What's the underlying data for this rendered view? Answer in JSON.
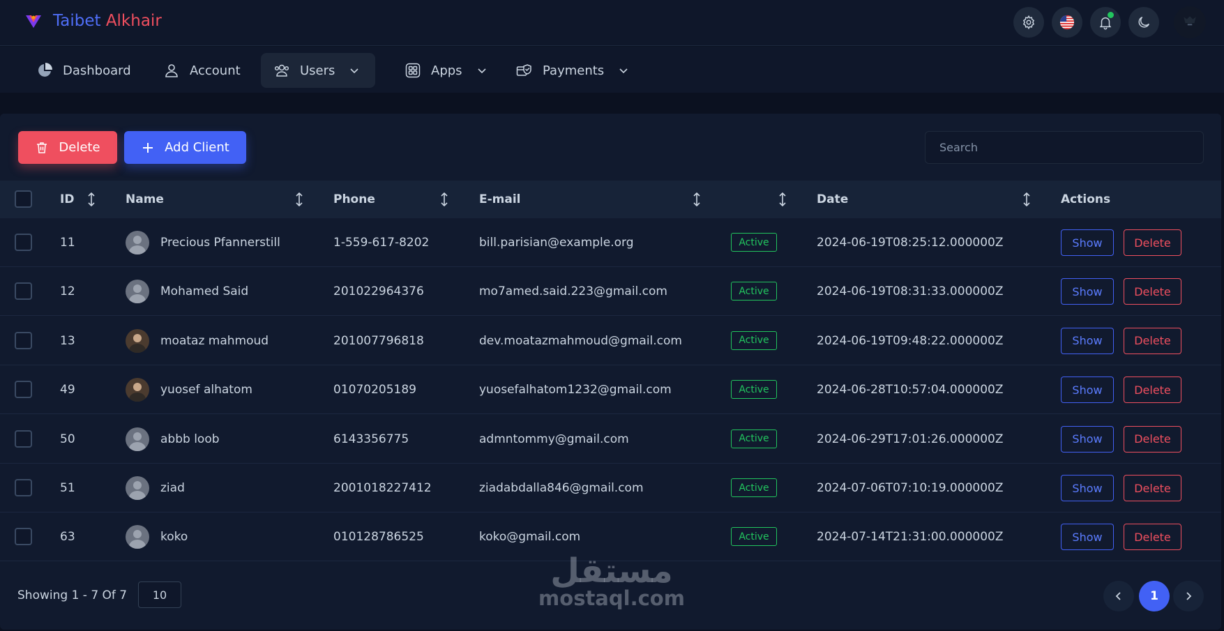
{
  "brand": {
    "part1": "Taibet",
    "part2": "Alkhair"
  },
  "topbar_icons": [
    "gear-icon",
    "us-flag-icon",
    "bell-icon",
    "moon-icon",
    "user-avatar"
  ],
  "nav": {
    "items": [
      {
        "label": "Dashboard",
        "icon": "pie-chart-icon",
        "dropdown": false
      },
      {
        "label": "Account",
        "icon": "user-icon",
        "dropdown": false
      },
      {
        "label": "Users",
        "icon": "users-icon",
        "dropdown": true,
        "active": true
      },
      {
        "label": "Apps",
        "icon": "grid-icon",
        "dropdown": true
      },
      {
        "label": "Payments",
        "icon": "payment-shield-icon",
        "dropdown": true
      }
    ]
  },
  "toolbar": {
    "delete_label": "Delete",
    "add_label": "Add Client",
    "search_placeholder": "Search"
  },
  "table": {
    "headers": {
      "id": "ID",
      "name": "Name",
      "phone": "Phone",
      "email": "E-mail",
      "status": "",
      "date": "Date",
      "actions": "Actions"
    },
    "show_label": "Show",
    "delete_label": "Delete",
    "rows": [
      {
        "id": "11",
        "name": "Precious Pfannerstill",
        "phone": "1-559-617-8202",
        "email": "bill.parisian@example.org",
        "status": "Active",
        "date": "2024-06-19T08:25:12.000000Z",
        "avatar": "default"
      },
      {
        "id": "12",
        "name": "Mohamed Said",
        "phone": "201022964376",
        "email": "mo7amed.said.223@gmail.com",
        "status": "Active",
        "date": "2024-06-19T08:31:33.000000Z",
        "avatar": "default"
      },
      {
        "id": "13",
        "name": "moataz mahmoud",
        "phone": "201007796818",
        "email": "dev.moatazmahmoud@gmail.com",
        "status": "Active",
        "date": "2024-06-19T09:48:22.000000Z",
        "avatar": "photo"
      },
      {
        "id": "49",
        "name": "yuosef alhatom",
        "phone": "01070205189",
        "email": "yuosefalhatom1232@gmail.com",
        "status": "Active",
        "date": "2024-06-28T10:57:04.000000Z",
        "avatar": "photo"
      },
      {
        "id": "50",
        "name": "abbb loob",
        "phone": "6143356775",
        "email": "admntommy@gmail.com",
        "status": "Active",
        "date": "2024-06-29T17:01:26.000000Z",
        "avatar": "default"
      },
      {
        "id": "51",
        "name": "ziad",
        "phone": "2001018227412",
        "email": "ziadabdalla846@gmail.com",
        "status": "Active",
        "date": "2024-07-06T07:10:19.000000Z",
        "avatar": "default"
      },
      {
        "id": "63",
        "name": "koko",
        "phone": "010128786525",
        "email": "koko@gmail.com",
        "status": "Active",
        "date": "2024-07-14T21:31:00.000000Z",
        "avatar": "default"
      }
    ]
  },
  "footer": {
    "showing": "Showing 1 - 7 Of 7",
    "per_page": "10",
    "current_page": "1"
  },
  "watermark": {
    "arabic": "مستقل",
    "latin": "mostaql.com"
  },
  "colors": {
    "primary": "#4261f5",
    "danger": "#ef4f5f",
    "success": "#22c55e",
    "background": "#0b1120"
  }
}
